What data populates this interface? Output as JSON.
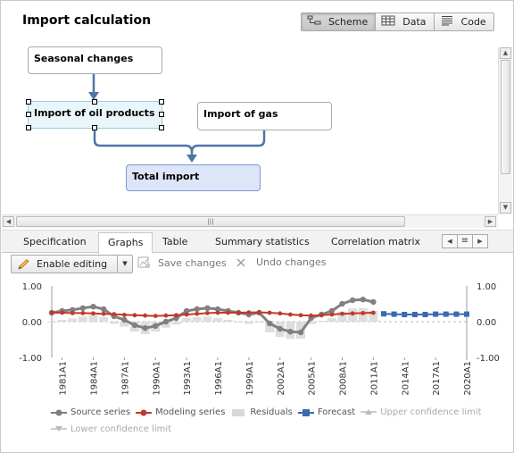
{
  "title": "Import calculation",
  "view_switch": [
    {
      "label": "Scheme",
      "icon": "scheme-icon",
      "active": true
    },
    {
      "label": "Data",
      "icon": "table-icon",
      "active": false
    },
    {
      "label": "Code",
      "icon": "code-icon",
      "active": false
    }
  ],
  "scheme": {
    "nodes": {
      "seasonal": "Seasonal changes",
      "oil": "Import of oil products",
      "gas": "Import of gas",
      "total": "Total import"
    }
  },
  "tabs": [
    "Specification",
    "Graphs",
    "Table",
    "Summary statistics",
    "Correlation matrix"
  ],
  "active_tab": "Graphs",
  "toolbar": {
    "enable_editing": "Enable editing",
    "save_changes": "Save changes",
    "undo_changes": "Undo changes"
  },
  "chart_data": {
    "type": "line",
    "x_ticks": [
      "1981A1",
      "1984A1",
      "1987A1",
      "1990A1",
      "1993A1",
      "1996A1",
      "1999A1",
      "2002A1",
      "2005A1",
      "2008A1",
      "2011A1",
      "2014A1",
      "2017A1",
      "2020A1"
    ],
    "y_ticks": [
      "1.00",
      "0.00",
      "-1.00"
    ],
    "ylim": [
      -1,
      1
    ],
    "xlim": [
      1980,
      2020
    ],
    "series": [
      {
        "name": "Source series",
        "color": "#808080",
        "x": [
          1980,
          1981,
          1982,
          1983,
          1984,
          1985,
          1986,
          1987,
          1988,
          1989,
          1990,
          1991,
          1992,
          1993,
          1994,
          1995,
          1996,
          1997,
          1998,
          1999,
          2000,
          2001,
          2002,
          2003,
          2004,
          2005,
          2006,
          2007,
          2008,
          2009,
          2010,
          2011
        ],
        "y": [
          0.25,
          0.3,
          0.33,
          0.38,
          0.42,
          0.35,
          0.15,
          0.05,
          -0.1,
          -0.18,
          -0.12,
          0.0,
          0.1,
          0.3,
          0.35,
          0.38,
          0.35,
          0.3,
          0.25,
          0.2,
          0.25,
          -0.05,
          -0.2,
          -0.28,
          -0.3,
          0.1,
          0.2,
          0.3,
          0.5,
          0.6,
          0.62,
          0.55
        ]
      },
      {
        "name": "Modeling series",
        "color": "#c0392b",
        "x": [
          1980,
          1981,
          1982,
          1983,
          1984,
          1985,
          1986,
          1987,
          1988,
          1989,
          1990,
          1991,
          1992,
          1993,
          1994,
          1995,
          1996,
          1997,
          1998,
          1999,
          2000,
          2001,
          2002,
          2003,
          2004,
          2005,
          2006,
          2007,
          2008,
          2009,
          2010,
          2011
        ],
        "y": [
          0.25,
          0.25,
          0.24,
          0.24,
          0.23,
          0.22,
          0.21,
          0.19,
          0.18,
          0.17,
          0.16,
          0.17,
          0.18,
          0.2,
          0.22,
          0.24,
          0.25,
          0.25,
          0.25,
          0.26,
          0.26,
          0.25,
          0.23,
          0.2,
          0.18,
          0.17,
          0.18,
          0.2,
          0.22,
          0.23,
          0.24,
          0.25
        ]
      },
      {
        "name": "Residuals",
        "color": "#d8d8d8",
        "x": [
          1980,
          1981,
          1982,
          1983,
          1984,
          1985,
          1986,
          1987,
          1988,
          1989,
          1990,
          1991,
          1992,
          1993,
          1994,
          1995,
          1996,
          1997,
          1998,
          1999,
          2000,
          2001,
          2002,
          2003,
          2004,
          2005,
          2006,
          2007,
          2008,
          2009,
          2010,
          2011
        ],
        "y": [
          0.0,
          0.05,
          0.09,
          0.14,
          0.19,
          0.13,
          -0.06,
          -0.14,
          -0.28,
          -0.35,
          -0.28,
          -0.17,
          -0.08,
          0.1,
          0.13,
          0.14,
          0.1,
          0.05,
          0.0,
          -0.06,
          -0.01,
          -0.3,
          -0.43,
          -0.48,
          -0.48,
          -0.07,
          0.02,
          0.1,
          0.28,
          0.37,
          0.38,
          0.3
        ]
      },
      {
        "name": "Forecast",
        "color": "#3a6ab0",
        "x": [
          2012,
          2013,
          2014,
          2015,
          2016,
          2017,
          2018,
          2019,
          2020
        ],
        "y": [
          0.22,
          0.21,
          0.2,
          0.2,
          0.2,
          0.21,
          0.21,
          0.21,
          0.21
        ]
      }
    ],
    "legend": [
      {
        "name": "Source series",
        "dim": false
      },
      {
        "name": "Modeling series",
        "dim": false
      },
      {
        "name": "Residuals",
        "dim": false
      },
      {
        "name": "Forecast",
        "dim": false
      },
      {
        "name": "Upper confidence limit",
        "dim": true
      },
      {
        "name": "Lower confidence limit",
        "dim": true
      }
    ]
  }
}
